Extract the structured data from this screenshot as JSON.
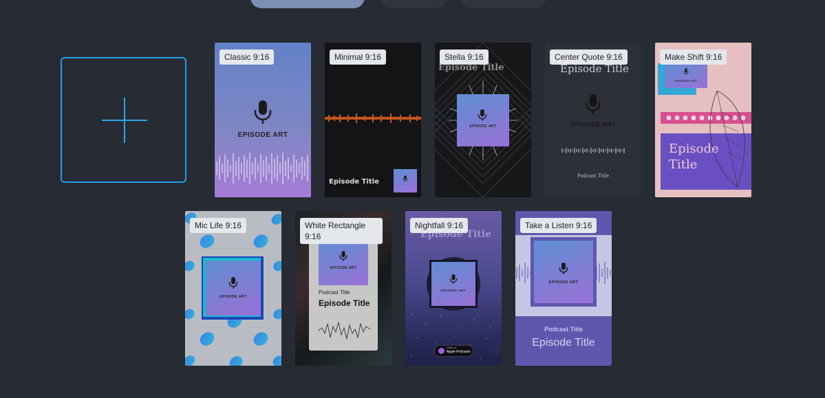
{
  "create_card": {
    "icon": "plus-icon"
  },
  "templates": [
    {
      "label": "Classic 9:16",
      "art_text": "EPISODE ART",
      "bg_gradient": [
        "#6184c8",
        "#a478d4"
      ]
    },
    {
      "label": "Minimal 9:16",
      "episode_title": "Episode Title",
      "wave_color": "#c4561a"
    },
    {
      "label": "Stella 9:16",
      "episode_title": "Episode Title",
      "art_text": "EPISODE ART"
    },
    {
      "label": "Center Quote 9:16",
      "episode_title": "Episode Title",
      "art_text": "EPISODE ART",
      "podcast_title": "Podcast Title"
    },
    {
      "label": "Make Shift 9:16",
      "episode_title": "Episode Title",
      "art_text": "EPISODE ART"
    },
    {
      "label": "Mic Life 9:16",
      "art_text": "EPISODE ART"
    },
    {
      "label": "White Rectangle 9:16",
      "art_text": "EPISODE ART",
      "podcast_title": "Podcast Title",
      "episode_title": "Episode Title"
    },
    {
      "label": "Nightfall 9:16",
      "episode_title": "Episode Title",
      "art_text": "EPISODE ART",
      "badge_line1": "Listen on",
      "badge_line2": "Apple Podcasts"
    },
    {
      "label": "Take a Listen 9:16",
      "art_text": "EPISODE ART",
      "podcast_title": "Podcast Title",
      "episode_title": "Episode Title"
    }
  ],
  "colors": {
    "accent": "#1f9ee8",
    "background": "#272b33",
    "label_bg": "#e4e7ec"
  }
}
